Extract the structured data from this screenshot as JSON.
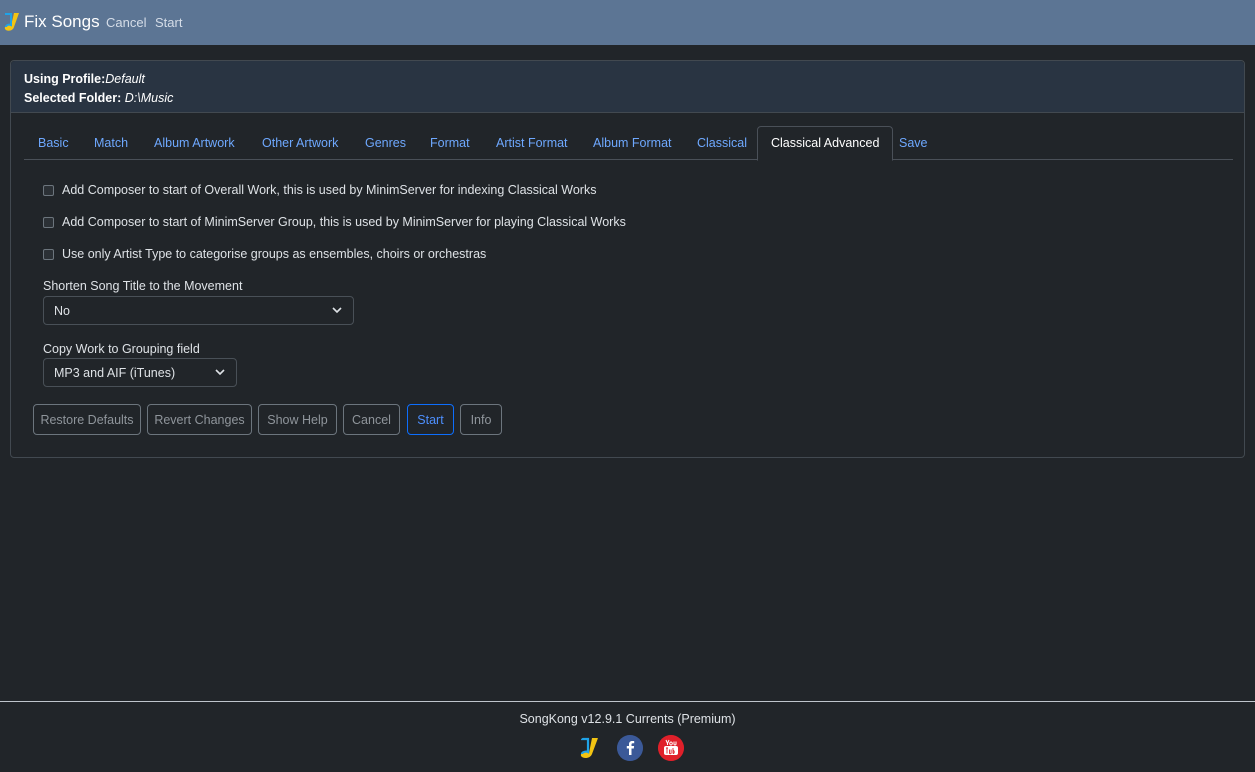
{
  "topbar": {
    "title": "Fix Songs",
    "cancel_label": "Cancel",
    "start_label": "Start"
  },
  "header": {
    "profile_label": "Using Profile:",
    "profile_value": "Default",
    "folder_label": "Selected Folder: ",
    "folder_value": "D:\\Music"
  },
  "tabs": [
    {
      "label": "Basic"
    },
    {
      "label": "Match"
    },
    {
      "label": "Album Artwork"
    },
    {
      "label": "Other Artwork"
    },
    {
      "label": "Genres"
    },
    {
      "label": "Format"
    },
    {
      "label": "Artist Format"
    },
    {
      "label": "Album Format"
    },
    {
      "label": "Classical"
    },
    {
      "label": "Classical Advanced",
      "active": true
    },
    {
      "label": "Save"
    }
  ],
  "options": [
    {
      "label": "Add Composer to start of Overall Work, this is used by MinimServer for indexing Classical Works",
      "checked": false
    },
    {
      "label": "Add Composer to start of MinimServer Group, this is used by MinimServer for playing Classical Works",
      "checked": false
    },
    {
      "label": "Use only Artist Type to categorise groups as ensembles, choirs or orchestras",
      "checked": false
    }
  ],
  "shorten": {
    "label": "Shorten Song Title to the Movement",
    "value": "No"
  },
  "copy_work": {
    "label": "Copy Work to Grouping field",
    "value": "MP3 and AIF (iTunes)"
  },
  "buttons": {
    "restore": "Restore Defaults",
    "revert": "Revert Changes",
    "help": "Show Help",
    "cancel": "Cancel",
    "start": "Start",
    "info": "Info"
  },
  "footer": {
    "version": "SongKong v12.9.1 Currents (Premium)"
  },
  "colors": {
    "topbar": "#5c7594",
    "background": "#212529",
    "link": "#6ea8fe",
    "primary": "#0d6efd"
  }
}
